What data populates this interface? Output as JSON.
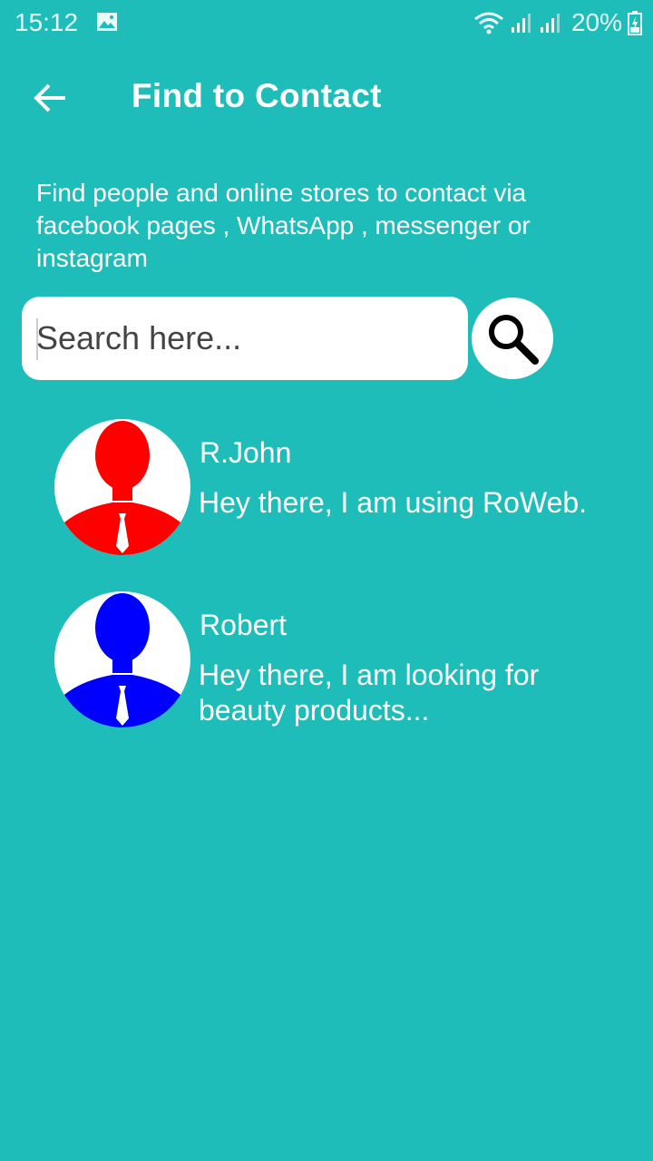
{
  "status_bar": {
    "time": "15:12",
    "battery": "20%",
    "icons": [
      "image-icon",
      "wifi-icon",
      "signal-icon-1",
      "signal-icon-2",
      "battery-icon"
    ]
  },
  "app_bar": {
    "title": "Find to Contact",
    "back_icon": "arrow-left-icon"
  },
  "description": "Find people and online stores to contact via facebook pages , WhatsApp , messenger or instagram",
  "search": {
    "placeholder": "Search here...",
    "value": "",
    "button_icon": "search-icon"
  },
  "contacts": [
    {
      "name": "R.John",
      "status": "Hey there, I am using RoWeb.",
      "avatar_icon": "person-avatar-icon",
      "avatar_color": "#ff0000"
    },
    {
      "name": "Robert",
      "status": "Hey there, I am looking for beauty products...",
      "avatar_icon": "person-avatar-icon",
      "avatar_color": "#0000ff"
    }
  ],
  "colors": {
    "background": "#1fbdb9",
    "text": "#ffffff",
    "search_bg": "#ffffff"
  }
}
